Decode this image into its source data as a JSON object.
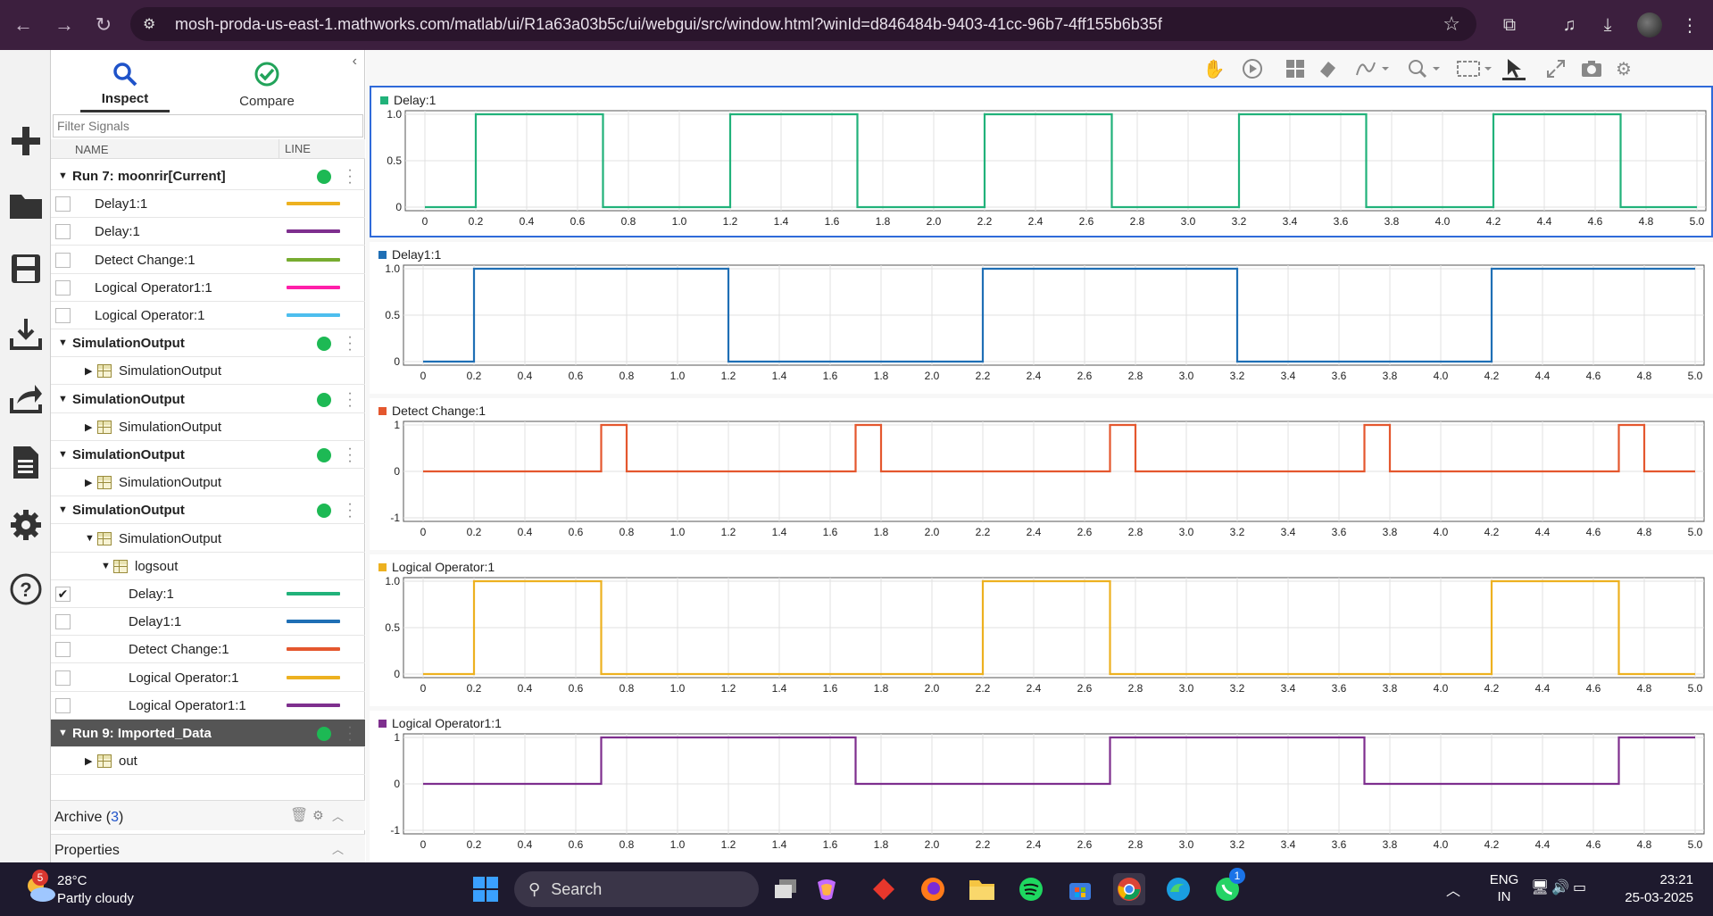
{
  "browser": {
    "url": "mosh-proda-us-east-1.mathworks.com/matlab/ui/R1a63a03b5c/ui/webgui/src/window.html?winId=d846484b-9403-41cc-96b7-4ff155b6b35f"
  },
  "panel": {
    "tabs": [
      {
        "label": "Inspect"
      },
      {
        "label": "Compare"
      }
    ],
    "filter_placeholder": "Filter Signals",
    "columns": {
      "name": "NAME",
      "line": "LINE"
    },
    "rows": [
      {
        "type": "group",
        "label": "Run 7: moonrir[Current]",
        "indent": 0,
        "expanded": true
      },
      {
        "type": "signal",
        "label": "Delay1:1",
        "indent": 1,
        "checked": false,
        "color": "#edb120"
      },
      {
        "type": "signal",
        "label": "Delay:1",
        "indent": 1,
        "checked": false,
        "color": "#7e2f8e"
      },
      {
        "type": "signal",
        "label": "Detect Change:1",
        "indent": 1,
        "checked": false,
        "color": "#77ac30"
      },
      {
        "type": "signal",
        "label": "Logical Operator1:1",
        "indent": 1,
        "checked": false,
        "color": "#ff1fa9"
      },
      {
        "type": "signal",
        "label": "Logical Operator:1",
        "indent": 1,
        "checked": false,
        "color": "#4dbeee"
      },
      {
        "type": "group",
        "label": "SimulationOutput",
        "indent": 0,
        "expanded": true
      },
      {
        "type": "node",
        "label": "SimulationOutput",
        "indent": 1,
        "expanded": false
      },
      {
        "type": "group",
        "label": "SimulationOutput",
        "indent": 0,
        "expanded": true
      },
      {
        "type": "node",
        "label": "SimulationOutput",
        "indent": 1,
        "expanded": false
      },
      {
        "type": "group",
        "label": "SimulationOutput",
        "indent": 0,
        "expanded": true
      },
      {
        "type": "node",
        "label": "SimulationOutput",
        "indent": 1,
        "expanded": false
      },
      {
        "type": "group",
        "label": "SimulationOutput",
        "indent": 0,
        "expanded": true
      },
      {
        "type": "node",
        "label": "SimulationOutput",
        "indent": 1,
        "expanded": true
      },
      {
        "type": "node",
        "label": "logsout",
        "indent": 2,
        "expanded": true
      },
      {
        "type": "signal",
        "label": "Delay:1",
        "indent": 3,
        "checked": true,
        "color": "#21b27a"
      },
      {
        "type": "signal",
        "label": "Delay1:1",
        "indent": 3,
        "checked": false,
        "color": "#1f6fb5"
      },
      {
        "type": "signal",
        "label": "Detect Change:1",
        "indent": 3,
        "checked": false,
        "color": "#e4572e"
      },
      {
        "type": "signal",
        "label": "Logical Operator:1",
        "indent": 3,
        "checked": false,
        "color": "#edb120"
      },
      {
        "type": "signal",
        "label": "Logical Operator1:1",
        "indent": 3,
        "checked": false,
        "color": "#7e2f8e"
      },
      {
        "type": "group",
        "label": "Run 9: Imported_Data",
        "indent": 0,
        "expanded": true,
        "selected": true
      },
      {
        "type": "node",
        "label": "out",
        "indent": 1,
        "expanded": false
      }
    ],
    "archive": {
      "label": "Archive (",
      "count": "3",
      "close": ")"
    },
    "properties": "Properties"
  },
  "chart_data": [
    {
      "type": "line",
      "title": "Delay:1",
      "color": "#21b27a",
      "x": [
        0,
        0.2,
        0.2,
        0.7,
        0.7,
        1.2,
        1.2,
        1.7,
        1.7,
        2.2,
        2.2,
        2.7,
        2.7,
        3.2,
        3.2,
        3.7,
        3.7,
        4.2,
        4.2,
        4.7,
        4.7,
        5.0
      ],
      "y": [
        0,
        0,
        1,
        1,
        0,
        0,
        1,
        1,
        0,
        0,
        1,
        1,
        0,
        0,
        1,
        1,
        0,
        0,
        1,
        1,
        0,
        0
      ],
      "xlim": [
        0,
        5.0
      ],
      "ylim": [
        0,
        1.0
      ],
      "yticks": [
        "0",
        "0.5",
        "1.0"
      ],
      "grid": true
    },
    {
      "type": "line",
      "title": "Delay1:1",
      "color": "#1f6fb5",
      "x": [
        0,
        0.2,
        0.2,
        1.2,
        1.2,
        2.2,
        2.2,
        3.2,
        3.2,
        4.2,
        4.2,
        5.0
      ],
      "y": [
        0,
        0,
        1,
        1,
        0,
        0,
        1,
        1,
        0,
        0,
        1,
        1
      ],
      "xlim": [
        0,
        5.0
      ],
      "ylim": [
        0,
        1.0
      ],
      "yticks": [
        "0",
        "0.5",
        "1.0"
      ],
      "grid": true
    },
    {
      "type": "line",
      "title": "Detect Change:1",
      "color": "#e4572e",
      "x": [
        0,
        0.7,
        0.7,
        0.8,
        0.8,
        1.7,
        1.7,
        1.8,
        1.8,
        2.7,
        2.7,
        2.8,
        2.8,
        3.7,
        3.7,
        3.8,
        3.8,
        4.7,
        4.7,
        4.8,
        4.8,
        5.0
      ],
      "y": [
        0,
        0,
        1,
        1,
        0,
        0,
        1,
        1,
        0,
        0,
        1,
        1,
        0,
        0,
        1,
        1,
        0,
        0,
        1,
        1,
        0,
        0
      ],
      "xlim": [
        0,
        5.0
      ],
      "ylim": [
        -1,
        1
      ],
      "yticks": [
        "-1",
        "0",
        "1"
      ],
      "grid": true
    },
    {
      "type": "line",
      "title": "Logical Operator:1",
      "color": "#edb120",
      "x": [
        0,
        0.2,
        0.2,
        0.7,
        0.7,
        2.2,
        2.2,
        2.7,
        2.7,
        4.2,
        4.2,
        4.7,
        4.7,
        5.0
      ],
      "y": [
        0,
        0,
        1,
        1,
        0,
        0,
        1,
        1,
        0,
        0,
        1,
        1,
        0,
        0
      ],
      "xlim": [
        0,
        5.0
      ],
      "ylim": [
        0,
        1.0
      ],
      "yticks": [
        "0",
        "0.5",
        "1.0"
      ],
      "grid": true
    },
    {
      "type": "line",
      "title": "Logical Operator1:1",
      "color": "#7e2f8e",
      "x": [
        0,
        0.7,
        0.7,
        1.7,
        1.7,
        2.7,
        2.7,
        3.7,
        3.7,
        4.7,
        4.7,
        5.0
      ],
      "y": [
        0,
        0,
        1,
        1,
        0,
        0,
        1,
        1,
        0,
        0,
        1,
        1
      ],
      "xlim": [
        0,
        5.0
      ],
      "ylim": [
        -1,
        1
      ],
      "yticks": [
        "-1",
        "0",
        "1"
      ],
      "grid": true
    }
  ],
  "xticks": [
    "0",
    "0.2",
    "0.4",
    "0.6",
    "0.8",
    "1.0",
    "1.2",
    "1.4",
    "1.6",
    "1.8",
    "2.0",
    "2.2",
    "2.4",
    "2.6",
    "2.8",
    "3.0",
    "3.2",
    "3.4",
    "3.6",
    "3.8",
    "4.0",
    "4.2",
    "4.4",
    "4.6",
    "4.8",
    "5.0"
  ],
  "taskbar": {
    "weather_temp": "28°C",
    "weather_desc": "Partly cloudy",
    "weather_badge": "5",
    "search": "Search",
    "whatsapp_badge": "1",
    "lang1": "ENG",
    "lang2": "IN",
    "time": "23:21",
    "date": "25-03-2025"
  }
}
